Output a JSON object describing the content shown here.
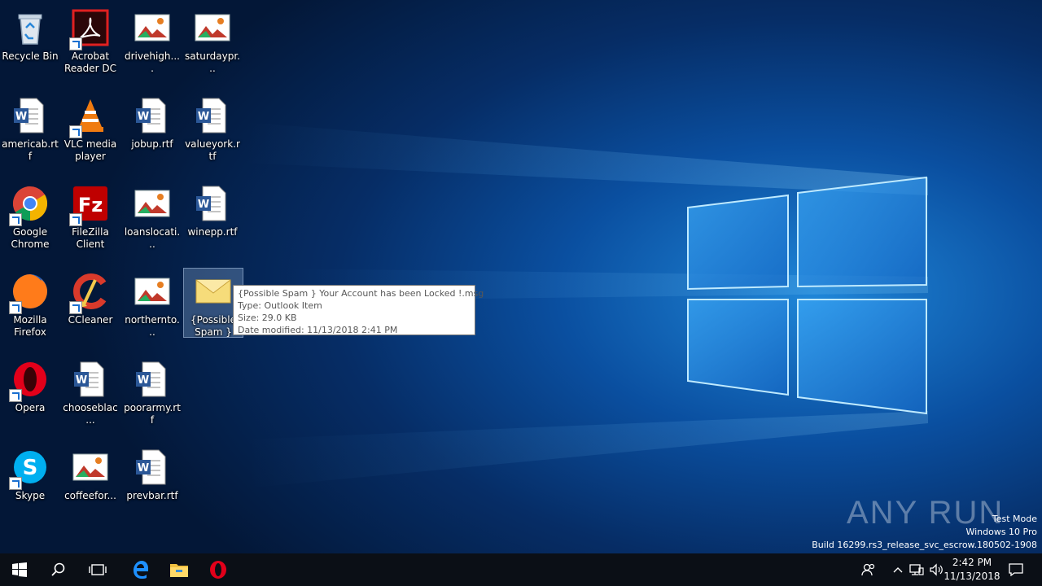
{
  "desktop": {
    "icons": [
      {
        "label": "Recycle Bin",
        "icon": "recycle-bin-icon"
      },
      {
        "label": "Acrobat Reader DC",
        "icon": "acrobat-icon"
      },
      {
        "label": "drivehigh....",
        "icon": "image-file-icon"
      },
      {
        "label": "saturdaypr...",
        "icon": "image-file-icon"
      },
      {
        "label": "americab.rtf",
        "icon": "word-document-icon"
      },
      {
        "label": "VLC media player",
        "icon": "vlc-icon"
      },
      {
        "label": "jobup.rtf",
        "icon": "word-document-icon"
      },
      {
        "label": "valueyork.rtf",
        "icon": "word-document-icon"
      },
      {
        "label": "Google Chrome",
        "icon": "chrome-icon"
      },
      {
        "label": "FileZilla Client",
        "icon": "filezilla-icon"
      },
      {
        "label": "loanslocati...",
        "icon": "image-file-icon"
      },
      {
        "label": "winepp.rtf",
        "icon": "word-document-icon"
      },
      {
        "label": "Mozilla Firefox",
        "icon": "firefox-icon"
      },
      {
        "label": "CCleaner",
        "icon": "ccleaner-icon"
      },
      {
        "label": "northernto...",
        "icon": "image-file-icon"
      },
      {
        "label": "{Possible Spam } Yo...",
        "icon": "envelope-icon"
      },
      {
        "label": "Opera",
        "icon": "opera-icon"
      },
      {
        "label": "chooseblac...",
        "icon": "word-document-icon"
      },
      {
        "label": "poorarmy.rtf",
        "icon": "word-document-icon"
      },
      {
        "label": "Skype",
        "icon": "skype-icon"
      },
      {
        "label": "coffeefor...",
        "icon": "image-file-icon"
      },
      {
        "label": "prevbar.rtf",
        "icon": "word-document-icon"
      }
    ]
  },
  "tooltip": {
    "name": "{Possible Spam } Your Account has been Locked  !.msg",
    "type": "Type: Outlook Item",
    "size": "Size: 29.0 KB",
    "date": "Date modified: 11/13/2018 2:41 PM"
  },
  "watermark": {
    "brand": "ANY RUN",
    "mode": "Test Mode",
    "edition": "Windows 10 Pro",
    "build": "Build 16299.rs3_release_svc_escrow.180502-1908"
  },
  "taskbar": {
    "start": "start-icon",
    "search": "search-icon",
    "task_view": "task-view-icon",
    "edge": "edge-icon",
    "explorer": "file-explorer-icon",
    "opera": "opera-icon",
    "time": "2:42 PM",
    "date": "11/13/2018"
  },
  "colors": {
    "taskbar_bg": "#0b0f16",
    "desktop_accent": "#1f86d8"
  }
}
